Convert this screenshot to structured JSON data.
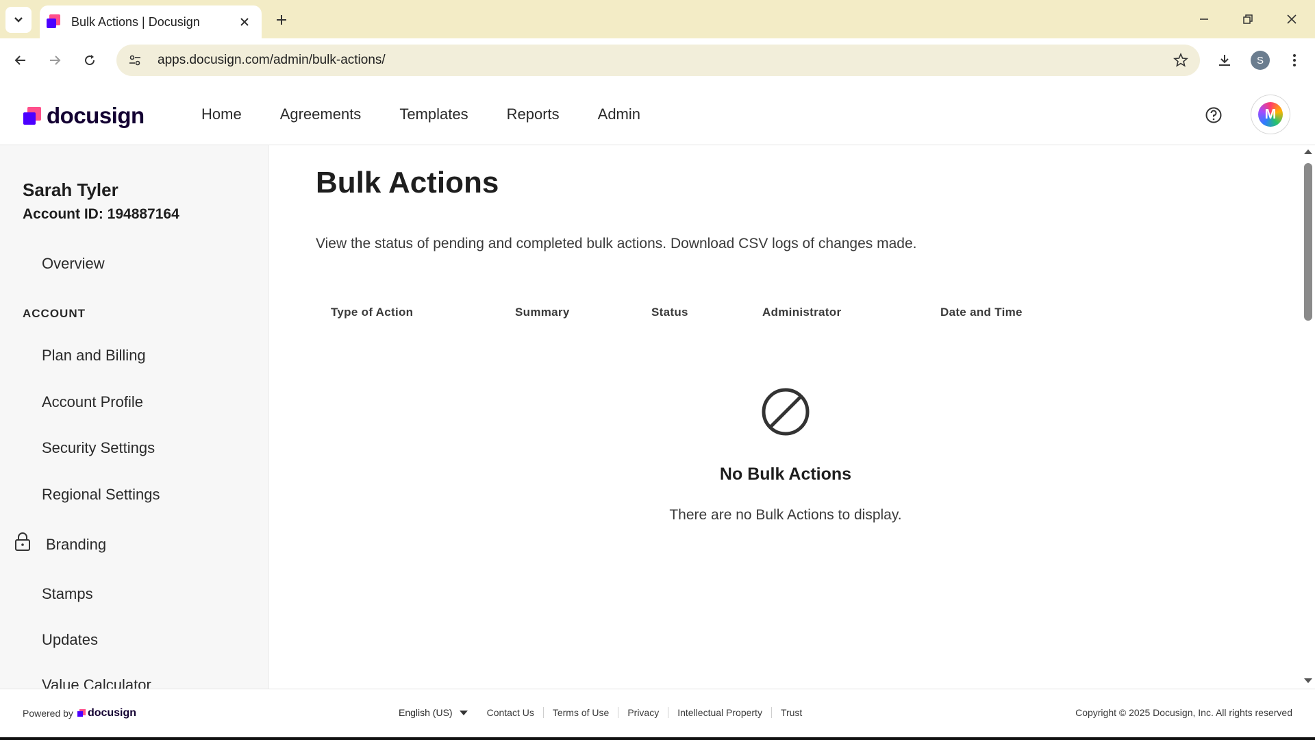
{
  "browser": {
    "tab_title": "Bulk Actions | Docusign",
    "url": "apps.docusign.com/admin/bulk-actions/",
    "profile_initial": "S"
  },
  "header": {
    "logo_text": "docusign",
    "nav": [
      "Home",
      "Agreements",
      "Templates",
      "Reports",
      "Admin"
    ],
    "avatar_initial": "M"
  },
  "sidebar": {
    "user_name": "Sarah Tyler",
    "account_id": "Account ID: 194887164",
    "overview": "Overview",
    "section_label": "ACCOUNT",
    "items": [
      "Plan and Billing",
      "Account Profile",
      "Security Settings",
      "Regional Settings",
      "Branding",
      "Stamps",
      "Updates",
      "Value Calculator"
    ]
  },
  "main": {
    "title": "Bulk Actions",
    "description": "View the status of pending and completed bulk actions. Download CSV logs of changes made.",
    "columns": [
      "Type of Action",
      "Summary",
      "Status",
      "Administrator",
      "Date and Time"
    ],
    "empty_title": "No Bulk Actions",
    "empty_text": "There are no Bulk Actions to display."
  },
  "footer": {
    "powered_by": "Powered by",
    "powered_logo": "docusign",
    "language": "English (US)",
    "links": [
      "Contact Us",
      "Terms of Use",
      "Privacy",
      "Intellectual Property",
      "Trust"
    ],
    "copyright": "Copyright © 2025 Docusign, Inc. All rights reserved"
  },
  "colors": {
    "brand_dark": "#130032",
    "brand_magenta": "#d0044f",
    "brand_purple": "#4c00ff",
    "tabstrip_bg": "#f3ecc6",
    "sidebar_bg": "#f7f7f7"
  }
}
